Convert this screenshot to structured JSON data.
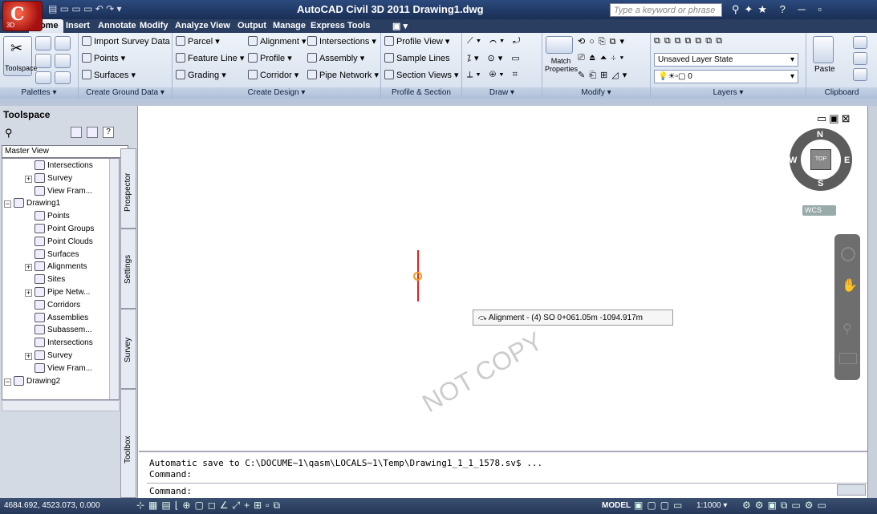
{
  "app": {
    "title": "AutoCAD Civil 3D 2011   Drawing1.dwg",
    "logo_text": "C",
    "logo_sub": "3D"
  },
  "search": {
    "placeholder": "Type a keyword or phrase"
  },
  "tabs": [
    "Home",
    "Insert",
    "Annotate",
    "Modify",
    "Analyze",
    "View",
    "Output",
    "Manage",
    "Express Tools"
  ],
  "ribbon": {
    "palettes": {
      "toolspace": "Toolspace",
      "label": "Palettes ▾"
    },
    "ground": {
      "items": [
        "Import Survey Data",
        "Points ▾",
        "Surfaces ▾"
      ],
      "label": "Create Ground Data ▾"
    },
    "design": {
      "items": [
        "Parcel ▾",
        "Feature Line ▾",
        "Grading ▾",
        "Alignment ▾",
        "Profile ▾",
        "Corridor ▾",
        "Intersections ▾",
        "Assembly ▾",
        "Pipe Network ▾"
      ],
      "label": "Create Design ▾"
    },
    "profile": {
      "items": [
        "Profile View ▾",
        "Sample Lines",
        "Section Views ▾"
      ],
      "label": "Profile & Section Views"
    },
    "draw": {
      "label": "Draw ▾"
    },
    "modify": {
      "match": "Match Properties",
      "label": "Modify ▾"
    },
    "layers": {
      "state": "Unsaved Layer State",
      "layer": "0",
      "label": "Layers ▾"
    },
    "clipboard": {
      "paste": "Paste",
      "label": "Clipboard"
    }
  },
  "toolspace": {
    "title": "Toolspace",
    "view": "Master View",
    "tree": [
      {
        "label": "Intersections",
        "level": 2
      },
      {
        "label": "Survey",
        "level": 2
      },
      {
        "label": "View Fram...",
        "level": 2
      },
      {
        "label": "Drawing1",
        "level": 1
      },
      {
        "label": "Points",
        "level": 2
      },
      {
        "label": "Point Groups",
        "level": 2
      },
      {
        "label": "Point Clouds",
        "level": 2
      },
      {
        "label": "Surfaces",
        "level": 2
      },
      {
        "label": "Alignments",
        "level": 2
      },
      {
        "label": "Sites",
        "level": 2
      },
      {
        "label": "Pipe Netw...",
        "level": 2
      },
      {
        "label": "Corridors",
        "level": 2
      },
      {
        "label": "Assemblies",
        "level": 2
      },
      {
        "label": "Subassem...",
        "level": 2
      },
      {
        "label": "Intersections",
        "level": 2
      },
      {
        "label": "Survey",
        "level": 2
      },
      {
        "label": "View Fram...",
        "level": 2
      },
      {
        "label": "Drawing2",
        "level": 1
      }
    ],
    "vtabs": [
      "Prospector",
      "Settings",
      "Survey",
      "Toolbox"
    ]
  },
  "viewcube": {
    "n": "N",
    "s": "S",
    "e": "E",
    "w": "W",
    "face": "TOP",
    "wcs": "WCS"
  },
  "tooltip": {
    "text": "Alignment - (4)  SO   0+061.05m   -1094.917m"
  },
  "watermark": "NOT COPY",
  "command": {
    "lines": [
      "Automatic save to C:\\DOCUME~1\\qasm\\LOCALS~1\\Temp\\Drawing1_1_1_1578.sv$ ...",
      "Command:",
      "Command:"
    ]
  },
  "status": {
    "coords": "4684.692, 4523.073, 0.000",
    "model": "MODEL",
    "scale": "1:1000 ▾"
  }
}
